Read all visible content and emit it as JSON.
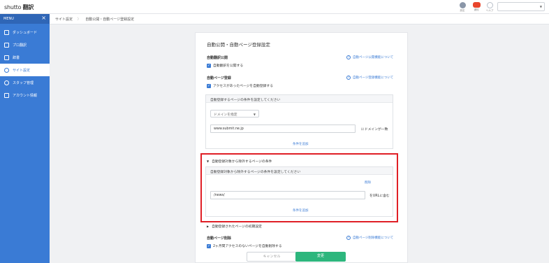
{
  "header": {
    "logo_main": "shutto",
    "logo_sub": "翻訳",
    "icons": [
      {
        "name": "settings-icon",
        "label": "設定",
        "color": "#8a96a8"
      },
      {
        "name": "notification-icon",
        "label": "通知",
        "color": "#e8452c"
      },
      {
        "name": "help-icon",
        "label": "ヘルプ",
        "color": "#b8bfc9"
      }
    ],
    "select_value": ""
  },
  "sidebar": {
    "menu_label": "MENU",
    "items": [
      {
        "label": "ダッシュボード",
        "icon": "home-icon"
      },
      {
        "label": "プロ翻訳",
        "icon": "grid-icon"
      },
      {
        "label": "辞書",
        "icon": "book-icon"
      },
      {
        "label": "サイト設定",
        "icon": "gear-icon",
        "active": true
      },
      {
        "label": "スタッフ管理",
        "icon": "users-icon"
      },
      {
        "label": "アカウント情報",
        "icon": "id-card-icon"
      }
    ]
  },
  "breadcrumb": {
    "items": [
      "サイト設定",
      "自動公開・自動ページ登録設定"
    ]
  },
  "main": {
    "title": "自動公開・自動ページ登録設定",
    "auto_publish": {
      "heading": "自動翻訳公開",
      "help": "自動ページ公開機能について",
      "checkbox": "自動翻訳を公開する"
    },
    "auto_register": {
      "heading": "自動ページ登録",
      "help": "自動ページ登録機能について",
      "checkbox": "アクセスがあったページを自動登録する",
      "panel_header": "自動登録するページの条件を設定してください",
      "dropdown": "ドメインを指定",
      "input_value": "www.submit.ne.jp",
      "suffix": "にドメインが一致",
      "add_link": "条件を追加"
    },
    "exclude": {
      "toggle_label": "自動登録対象から除外するページの条件",
      "panel_header": "自動登録対象から除外するページの条件を設定してください",
      "delete_link": "削除",
      "input_value": "/news/",
      "suffix": "をURLに含む",
      "add_link": "条件を追加"
    },
    "initial_settings": {
      "toggle_label": "自動登録されたページの初期設定"
    },
    "auto_delete": {
      "heading": "自動ページ削除",
      "help": "自動ページ削除機能について",
      "checkbox": "2ヶ月間アクセスのないページを自動削除する"
    },
    "buttons": {
      "cancel": "キャンセル",
      "save": "変更"
    }
  },
  "colors": {
    "sidebar": "#3a7bd5",
    "highlight": "#e01f26",
    "save": "#2db67d"
  }
}
